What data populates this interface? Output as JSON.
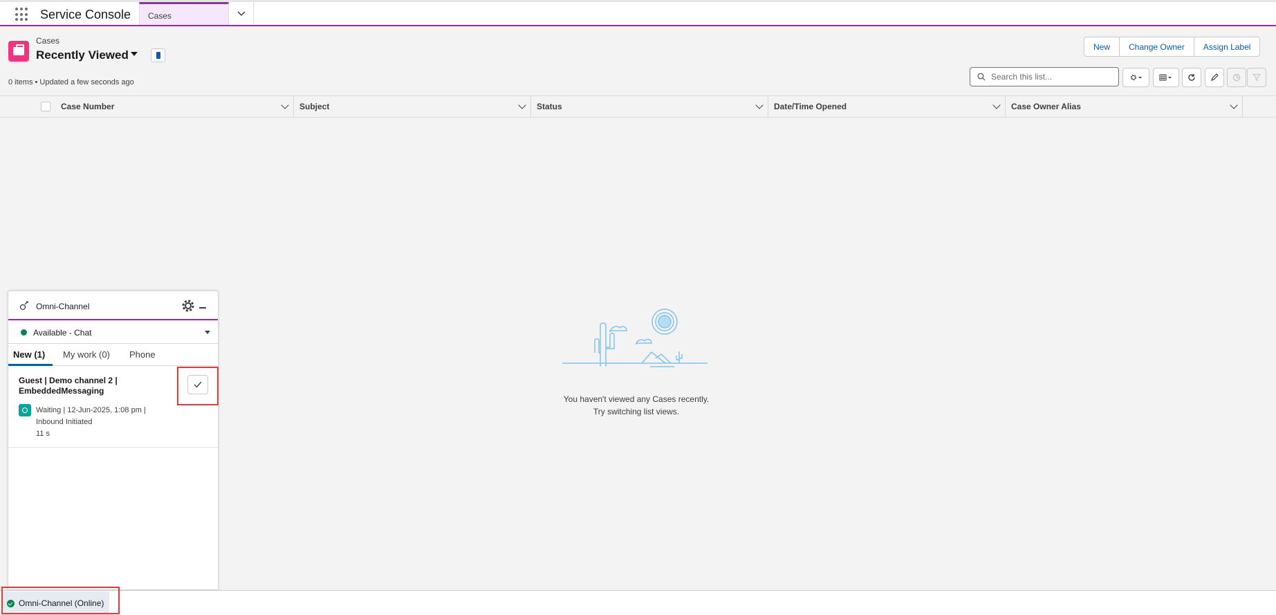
{
  "topbar": {
    "app_name": "Service Console",
    "tabs": [
      {
        "label": "Cases"
      }
    ]
  },
  "list_view": {
    "object_label": "Cases",
    "view_title": "Recently Viewed",
    "meta": "0 items • Updated a few seconds ago",
    "buttons": {
      "new": "New",
      "change_owner": "Change Owner",
      "assign_label": "Assign Label"
    },
    "search_placeholder": "Search this list...",
    "columns": [
      "Case Number",
      "Subject",
      "Status",
      "Date/Time Opened",
      "Case Owner Alias"
    ],
    "empty_line1": "You haven't viewed any Cases recently.",
    "empty_line2": "Try switching list views."
  },
  "omni": {
    "title": "Omni-Channel",
    "status": "Available - Chat",
    "tabs": [
      "New (1)",
      "My work (0)",
      "Phone"
    ],
    "work_item": {
      "title": "Guest | Demo channel 2 | EmbeddedMessaging",
      "status_line": "Waiting | 12-Jun-2025, 1:08 pm |",
      "origin": "Inbound Initiated",
      "elapsed": "11 s"
    }
  },
  "utility_bar": {
    "omni_label": "Omni-Channel (Online)"
  },
  "colors": {
    "brand_purple": "#9c27b0",
    "case_icon": "#f2337d",
    "link_blue": "#0b5cab",
    "online_green": "#04844b",
    "highlight_red": "#e53935"
  }
}
